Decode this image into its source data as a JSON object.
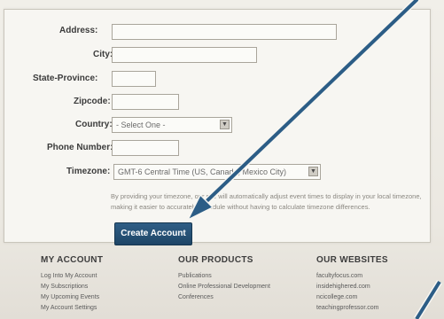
{
  "form": {
    "fields": {
      "address": {
        "label": "Address:",
        "value": ""
      },
      "city": {
        "label": "City:",
        "value": ""
      },
      "state": {
        "label": "State-Province:",
        "value": ""
      },
      "zipcode": {
        "label": "Zipcode:",
        "value": ""
      },
      "country": {
        "label": "Country:",
        "selected": "- Select One -"
      },
      "phone": {
        "label": "Phone Number:",
        "value": ""
      },
      "timezone": {
        "label": "Timezone:",
        "selected": "GMT-6 Central Time (US, Canada, Mexico City)"
      }
    },
    "hint_line1": "By providing your timezone, our site will automatically adjust event times to display in your local timezone,",
    "hint_line2": "making it easier to accurately schedule without having to calculate timezone differences.",
    "submit_label": "Create Account"
  },
  "footer": {
    "my_account": {
      "title": "MY ACCOUNT",
      "items": [
        "Log Into My Account",
        "My Subscriptions",
        "My Upcoming Events",
        "My Account Settings"
      ]
    },
    "our_products": {
      "title": "OUR PRODUCTS",
      "items": [
        "Publications",
        "Online Professional Development",
        "Conferences"
      ]
    },
    "our_websites": {
      "title": "OUR WEBSITES",
      "items": [
        "facultyfocus.com",
        "insidehighered.com",
        "ncicollege.com",
        "teachingprofessor.com"
      ]
    }
  },
  "colors": {
    "button": "#244d71",
    "arrow": "#2c5d86"
  }
}
